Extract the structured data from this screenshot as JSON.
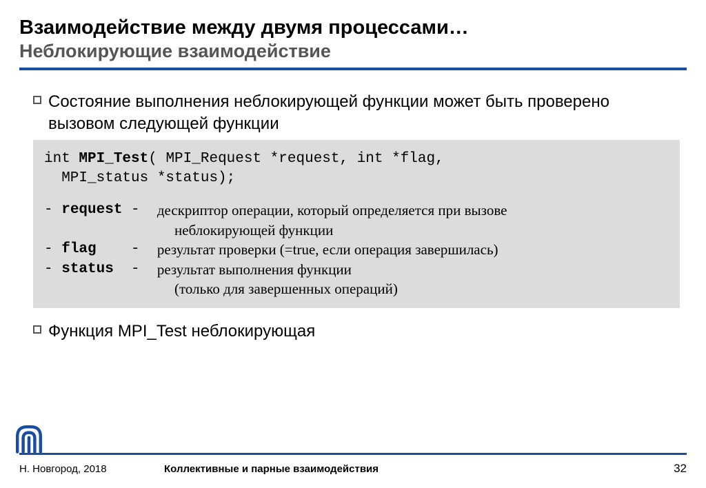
{
  "title": {
    "main": "Взаимодействие между двумя процессами…",
    "sub": "Неблокирующие взаимодействие"
  },
  "bullets": {
    "intro": "Состояние выполнения неблокирующей функции может быть проверено вызовом следующей функции",
    "outro": "Функция MPI_Test неблокирующая"
  },
  "code": {
    "sig_pre": "int ",
    "sig_fn": "MPI_Test",
    "sig_rest1": "( MPI_Request *request, int *flag,",
    "sig_rest2": "  MPI_status *status);",
    "params": [
      {
        "dash1": "- ",
        "key": "request",
        "dash2": " -  ",
        "desc1": "дескриптор операции, который определяется при вызове",
        "desc2": "неблокирующей функции"
      },
      {
        "dash1": "- ",
        "key": "flag   ",
        "dash2": " -  ",
        "desc1": "результат проверки (=true, если операция завершилась)",
        "desc2": ""
      },
      {
        "dash1": "- ",
        "key": "status ",
        "dash2": " -  ",
        "desc1": "результат выполнения функции",
        "desc2": "(только для завершенных операций)"
      }
    ]
  },
  "footer": {
    "left": "Н. Новгород, 2018",
    "center": "Коллективные и парные взаимодействия",
    "page": "32"
  }
}
